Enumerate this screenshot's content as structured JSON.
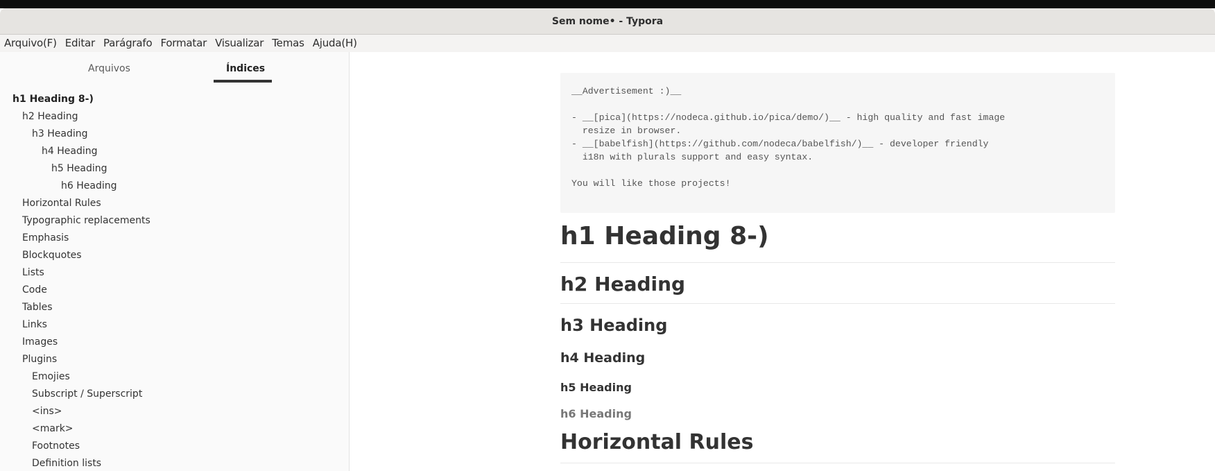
{
  "window": {
    "title": "Sem nome• - Typora"
  },
  "menu": [
    "Arquivo(F)",
    "Editar",
    "Parágrafo",
    "Formatar",
    "Visualizar",
    "Temas",
    "Ajuda(H)"
  ],
  "sidebar": {
    "tabs": {
      "files": "Arquivos",
      "toc": "Índices"
    },
    "toc": [
      "h1 Heading 8-)",
      "h2 Heading",
      "h3 Heading",
      "h4 Heading",
      "h5 Heading",
      "h6 Heading",
      "Horizontal Rules",
      "Typographic replacements",
      "Emphasis",
      "Blockquotes",
      "Lists",
      "Code",
      "Tables",
      "Links",
      "Images",
      "Plugins",
      "Emojies",
      "Subscript / Superscript",
      "<ins>",
      "<mark>",
      "Footnotes",
      "Definition lists"
    ]
  },
  "editor": {
    "code": "__Advertisement :)__\n\n- __[pica](https://nodeca.github.io/pica/demo/)__ - high quality and fast image\n  resize in browser.\n- __[babelfish](https://github.com/nodeca/babelfish/)__ - developer friendly\n  i18n with plurals support and easy syntax.\n\nYou will like those projects!",
    "h1": "h1 Heading 8-)",
    "h2": "h2 Heading",
    "h3": "h3 Heading",
    "h4": "h4 Heading",
    "h5": "h5 Heading",
    "h6": "h6 Heading",
    "h1b": "Horizontal Rules"
  }
}
